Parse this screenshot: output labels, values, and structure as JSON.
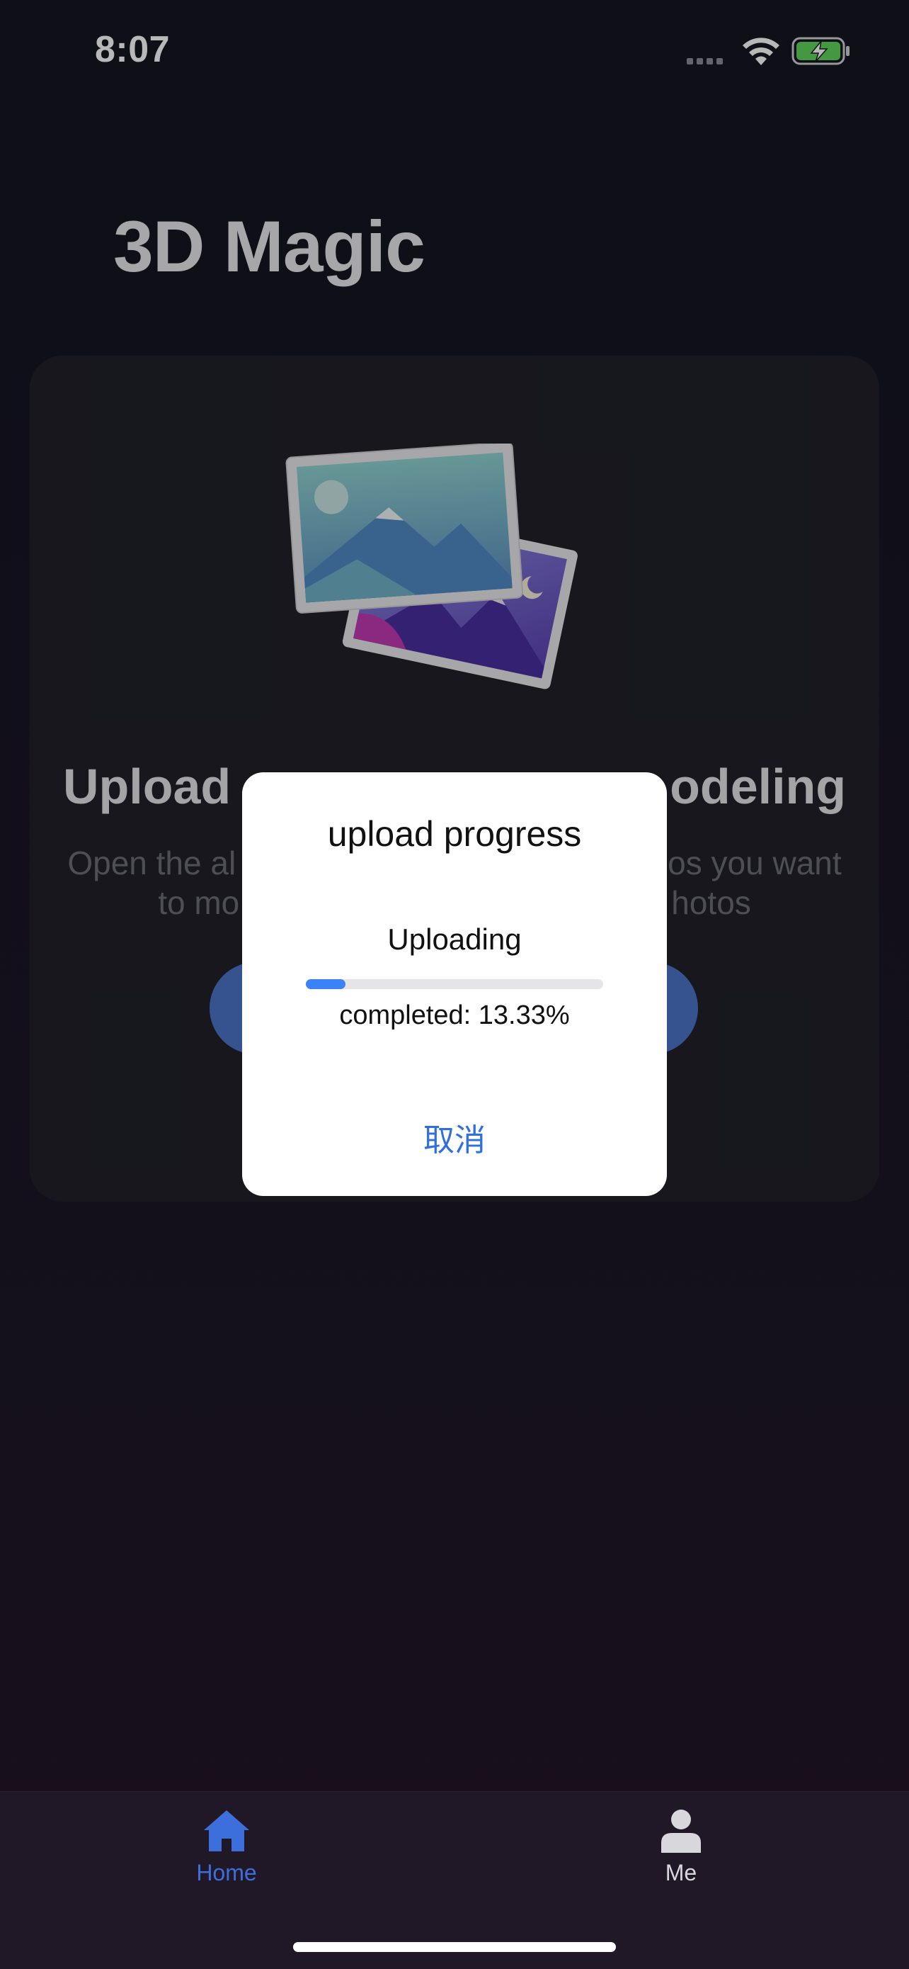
{
  "status_bar": {
    "time": "8:07",
    "icons": [
      "cellular-signal-icon",
      "wifi-icon",
      "battery-charging-icon"
    ],
    "battery_color": "#5dd35b"
  },
  "app": {
    "title": "3D Magic"
  },
  "card": {
    "illustration": "photos-icon",
    "heading_visible_left": "Upload",
    "heading_visible_right": "odeling",
    "description_line1_left": "Open the al",
    "description_line1_right": "os you want",
    "description_line2_left": "to mo",
    "description_line2_right": "hotos",
    "button_color": "#4b74c7"
  },
  "dialog": {
    "title": "upload progress",
    "status": "Uploading",
    "progress_percent": 13.33,
    "completed_text": "completed: 13.33%",
    "cancel_label": "取消",
    "accent_color": "#3b82f6"
  },
  "tabbar": {
    "items": [
      {
        "label": "Home",
        "icon": "home-icon",
        "active": true
      },
      {
        "label": "Me",
        "icon": "person-icon",
        "active": false
      }
    ],
    "active_color": "#3d6fdc"
  }
}
